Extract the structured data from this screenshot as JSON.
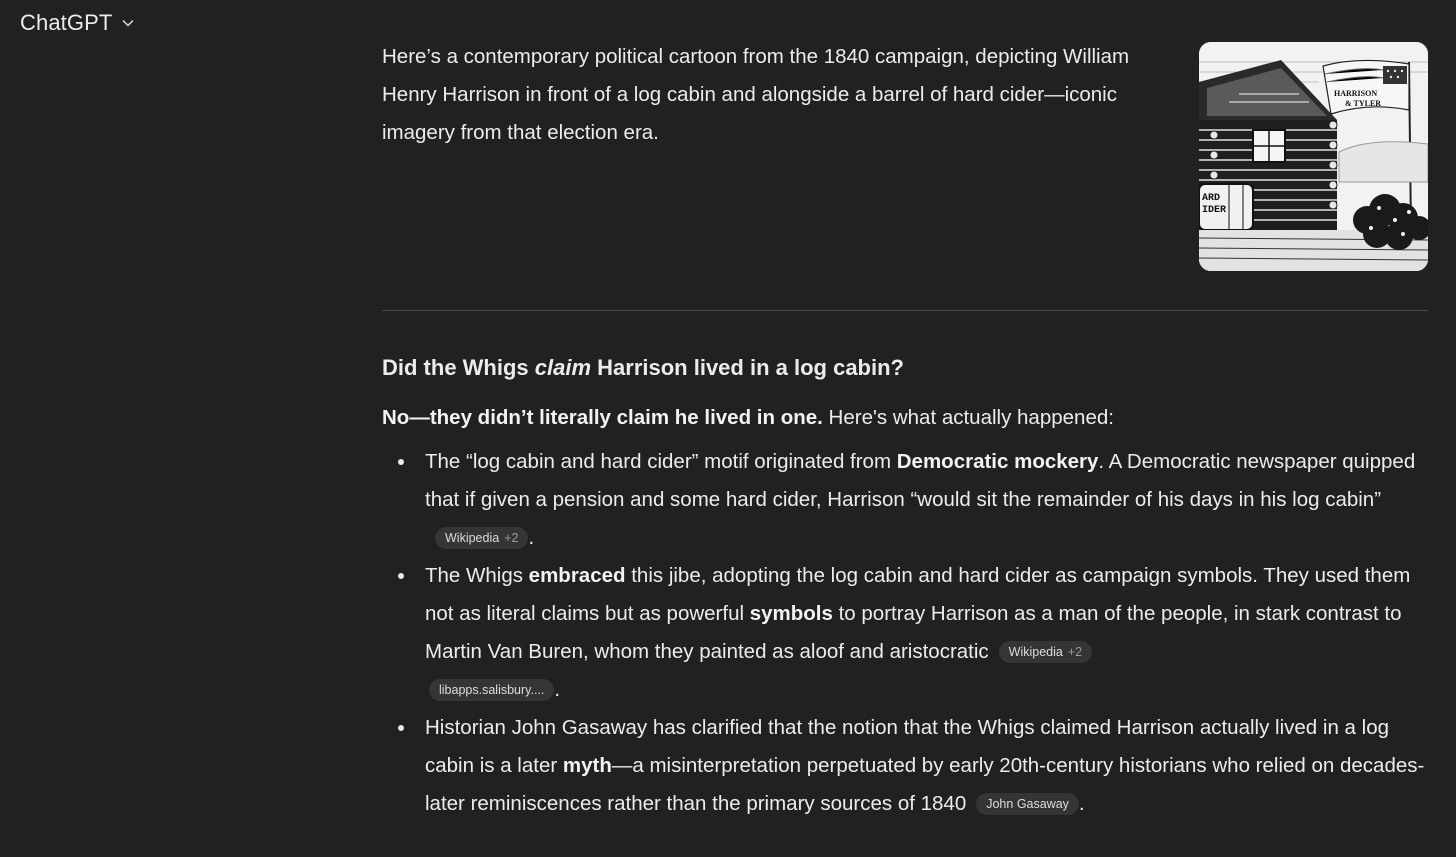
{
  "header": {
    "title": "ChatGPT",
    "chevron_icon": "chevron-down-icon"
  },
  "intro": {
    "text": "Here’s a contemporary political cartoon from the 1840 campaign, depicting William Henry Harrison in front of a log cabin and alongside a barrel of hard cider—iconic imagery from that election era."
  },
  "image": {
    "flag_text_1": "HARRISON",
    "flag_text_2": "& TYLER",
    "barrel_text_1": "ARD",
    "barrel_text_2": "IDER"
  },
  "heading": {
    "pre": "Did the Whigs ",
    "emph": "claim",
    "post": " Harrison lived in a log cabin?"
  },
  "lead": {
    "bold": "No—they didn’t literally claim he lived in one.",
    "rest": " Here's what actually happened:"
  },
  "bullets": [
    {
      "t1": "The “log cabin and hard cider” motif originated from ",
      "b1": "Democratic mockery",
      "t2": ". A Democratic newspaper quipped that if given a pension and some hard cider, Harrison “would sit the remainder of his days in his log cabin”",
      "chip": {
        "label": "Wikipedia",
        "extra": "+2"
      },
      "end": "."
    },
    {
      "t1": "The Whigs ",
      "b1": "embraced",
      "t2": " this jibe, adopting the log cabin and hard cider as campaign symbols. They used them not as literal claims but as powerful ",
      "b2": "symbols",
      "t3": " to portray Harrison as a man of the people, in stark contrast to Martin Van Buren, whom they painted as aloof and aristocratic",
      "chip": {
        "label": "Wikipedia",
        "extra": "+2"
      },
      "chip2": {
        "label": "libapps.salisbury...."
      },
      "end": "."
    },
    {
      "t1": "Historian John Gasaway has clarified that the notion that the Whigs claimed Harrison actually lived in a log cabin is a later ",
      "b1": "myth",
      "t2": "—a misinterpretation perpetuated by early 20th-century historians who relied on decades-later reminiscences rather than the primary sources of 1840",
      "chip": {
        "label": "John Gasaway"
      },
      "end": "."
    }
  ]
}
